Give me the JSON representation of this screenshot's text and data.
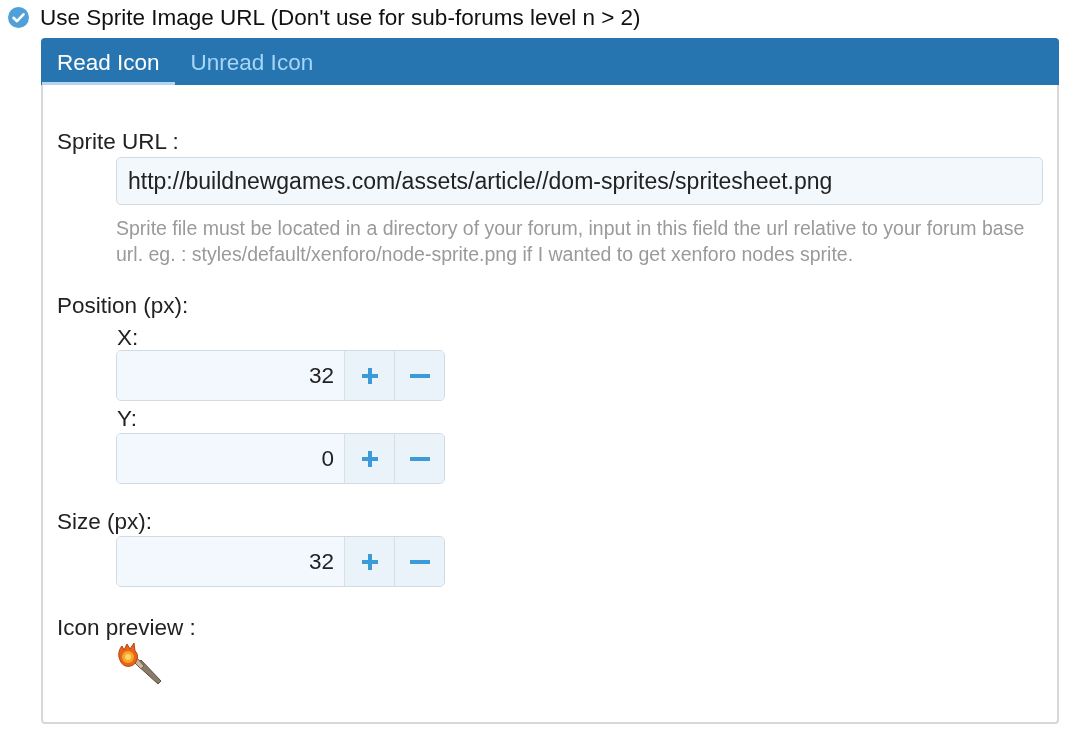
{
  "option": {
    "label": "Use Sprite Image URL (Don't use for sub-forums level n > 2)",
    "checked": true
  },
  "tabs": [
    {
      "label": "Read Icon",
      "selected": true
    },
    {
      "label": "Unread Icon",
      "selected": false
    }
  ],
  "sprite_url": {
    "label": "Sprite URL :",
    "value": "http://buildnewgames.com/assets/article//dom-sprites/spritesheet.png",
    "hint": "Sprite file must be located in a directory of your forum, input in this field the url relative to your forum base url. eg. : styles/default/xenforo/node-sprite.png if I wanted to get xenforo nodes sprite."
  },
  "position": {
    "label": "Position (px):",
    "axes": [
      {
        "label": "X:",
        "value": "32"
      },
      {
        "label": "Y:",
        "value": "0"
      }
    ]
  },
  "size": {
    "label": "Size (px):",
    "value": "32"
  },
  "preview": {
    "label": "Icon preview :"
  }
}
